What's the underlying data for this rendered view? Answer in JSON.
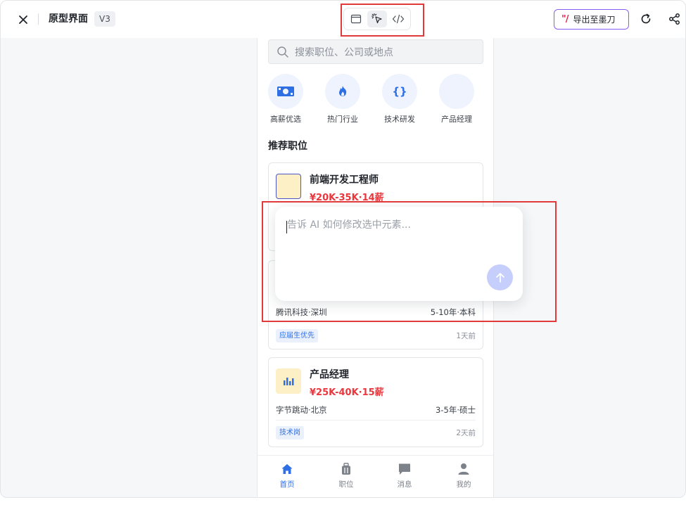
{
  "header": {
    "title": "原型界面",
    "version": "V3",
    "export_label": "导出至墨刀",
    "export_logo": "\"/",
    "modes": [
      "preview-icon",
      "select-cursor-icon",
      "code-icon"
    ]
  },
  "search": {
    "placeholder": "搜索职位、公司或地点"
  },
  "categories": [
    {
      "label": "高薪优选",
      "icon": "money-icon"
    },
    {
      "label": "热门行业",
      "icon": "fire-icon"
    },
    {
      "label": "技术研发",
      "icon": "braces-icon",
      "glyph": "{}"
    },
    {
      "label": "产品经理",
      "icon": ""
    }
  ],
  "section_title": "推荐职位",
  "jobs": [
    {
      "title": "前端开发工程师",
      "salary": "¥20K-35K·14薪"
    },
    {
      "company": "腾讯科技·深圳",
      "requirement": "5-10年·本科",
      "tag": "应届生优先",
      "time": "1天前"
    },
    {
      "title": "产品经理",
      "salary": "¥25K-40K·15薪",
      "company": "字节跳动·北京",
      "requirement": "3-5年·硕士",
      "tag": "技术岗",
      "time": "2天前"
    }
  ],
  "ai_prompt": {
    "placeholder": "告诉 AI 如何修改选中元素..."
  },
  "nav": [
    {
      "label": "首页",
      "icon": "home-icon",
      "active": true
    },
    {
      "label": "职位",
      "icon": "briefcase-icon",
      "active": false
    },
    {
      "label": "消息",
      "icon": "message-icon",
      "active": false
    },
    {
      "label": "我的",
      "icon": "user-icon",
      "active": false
    }
  ],
  "colors": {
    "accent": "#2f6fe4",
    "salary": "#e8373d",
    "highlight_box": "#e03a3a",
    "export_border": "#8b5cf6"
  }
}
